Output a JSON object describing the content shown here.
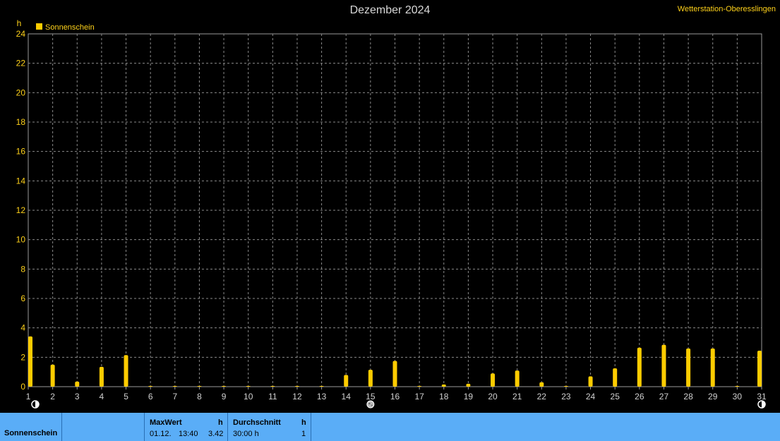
{
  "station_label": "Wetterstation-Oberesslingen",
  "chart_data": {
    "type": "bar",
    "title": "Dezember 2024",
    "ylabel": "h",
    "ylim": [
      0,
      24
    ],
    "y_ticks": [
      0,
      2,
      4,
      6,
      8,
      10,
      12,
      14,
      16,
      18,
      20,
      22,
      24
    ],
    "x": [
      1,
      2,
      3,
      4,
      5,
      6,
      7,
      8,
      9,
      10,
      11,
      12,
      13,
      14,
      15,
      16,
      17,
      18,
      19,
      20,
      21,
      22,
      23,
      24,
      25,
      26,
      27,
      28,
      29,
      30,
      31
    ],
    "series": [
      {
        "name": "Sonnenschein",
        "color": "#ffcc00",
        "values": [
          3.42,
          1.5,
          0.35,
          1.35,
          2.15,
          0.05,
          0.05,
          0.05,
          0.05,
          0.05,
          0.05,
          0.05,
          0.05,
          0.8,
          1.15,
          1.75,
          0.05,
          0.15,
          0.2,
          0.9,
          1.1,
          0.3,
          0.05,
          0.7,
          1.25,
          2.65,
          2.85,
          2.6,
          2.6,
          0.05,
          2.45
        ]
      }
    ],
    "grid": true,
    "legend": "top-left",
    "moon_markers": [
      {
        "day": 1,
        "icon": "new-moon-icon"
      },
      {
        "day": 15,
        "icon": "full-moon-icon"
      },
      {
        "day": 31,
        "icon": "new-moon-icon"
      }
    ]
  },
  "footer": {
    "row_label": "Sonnenschein",
    "maxwert": {
      "title": "MaxWert",
      "unit": "h",
      "date": "01.12.",
      "time": "13:40",
      "value": "3.42"
    },
    "durchschnitt": {
      "title": "Durchschnitt",
      "unit": "h",
      "value": "30:00 h",
      "count": "1"
    }
  }
}
